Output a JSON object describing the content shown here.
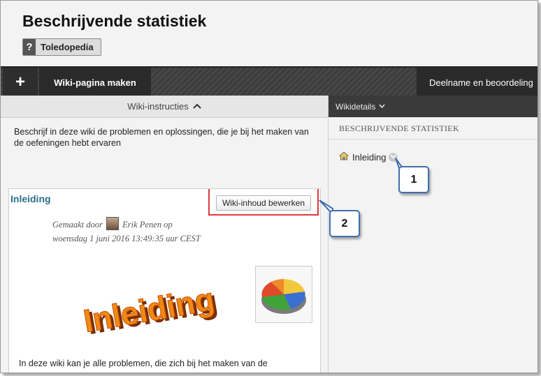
{
  "page": {
    "title": "Beschrijvende statistiek",
    "help_badge": {
      "icon": "?",
      "label": "Toledopedia"
    }
  },
  "toolbar": {
    "add_icon": "+",
    "create_page": "Wiki-pagina maken",
    "participation": "Deelname en beoordeling"
  },
  "instructions": {
    "toggle_label": "Wiki-instructies",
    "text": "Beschrijf in deze wiki de problemen en oplossingen, die je bij het maken van de oefeningen hebt ervaren"
  },
  "wiki_page": {
    "title": "Inleiding",
    "edit_button": "Wiki-inhoud bewerken",
    "meta_line1_prefix": "Gemaakt door",
    "meta_line1_author": "Erik Penen op",
    "meta_line2": "woensdag 1 juni 2016 13:49:35 uur CEST",
    "banner_text": "Inleiding",
    "body_text": "In deze wiki kan je alle problemen, die zich bij het maken van de"
  },
  "wiki_details": {
    "toggle_label": "Wikidetails",
    "heading": "BESCHRIJVENDE STATISTIEK",
    "pages": [
      {
        "label": "Inleiding",
        "icon": "house-icon"
      }
    ]
  },
  "callouts": {
    "one": "1",
    "two": "2"
  },
  "colors": {
    "highlight": "#e03a3a",
    "callout_border": "#3f6fb0",
    "title_link": "#2a6f8a"
  }
}
